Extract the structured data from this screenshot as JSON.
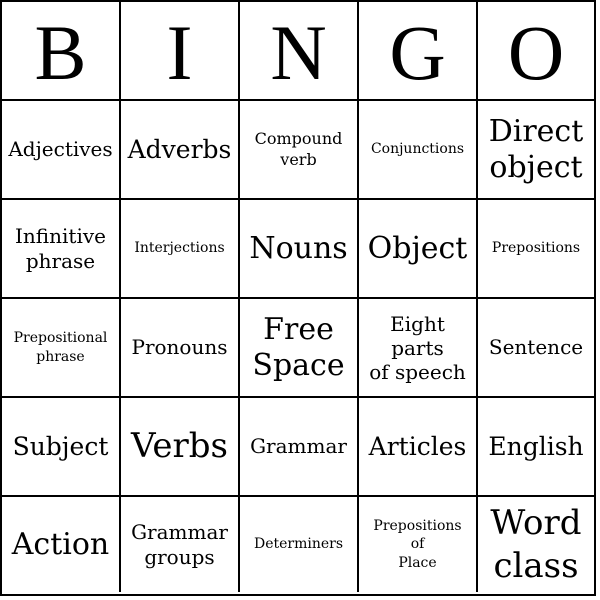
{
  "card": {
    "header": [
      "B",
      "I",
      "N",
      "G",
      "O"
    ],
    "rows": [
      [
        "Adjectives",
        "Adverbs",
        "Compound\nverb",
        "Conjunctions",
        "Direct\nobject"
      ],
      [
        "Infinitive\nphrase",
        "Interjections",
        "Nouns",
        "Object",
        "Prepositions"
      ],
      [
        "Prepositional\nphrase",
        "Pronouns",
        "Free\nSpace",
        "Eight\nparts\nof speech",
        "Sentence"
      ],
      [
        "Subject",
        "Verbs",
        "Grammar",
        "Articles",
        "English"
      ],
      [
        "Action",
        "Grammar\ngroups",
        "Determiners",
        "Prepositions\nof\nPlace",
        "Word\nclass"
      ]
    ]
  },
  "colors": {
    "background": "#ffffff",
    "grid_lines": "#000000",
    "text": "#000000"
  }
}
